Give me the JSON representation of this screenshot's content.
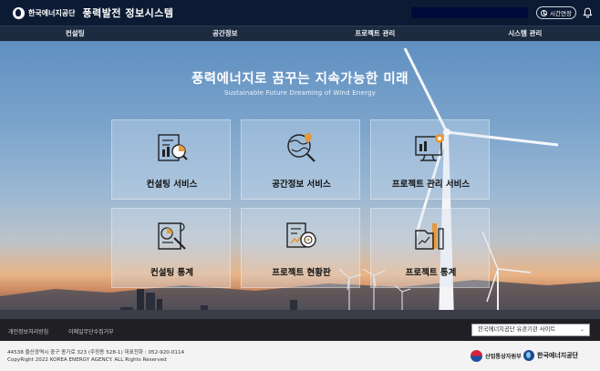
{
  "header": {
    "org_logo_text": "한국에너지공단",
    "system_title": "풍력발전 정보시스템",
    "ext_button_label": "시간연장"
  },
  "nav": {
    "items": [
      {
        "label": "컨설팅"
      },
      {
        "label": "공간정보"
      },
      {
        "label": "프로젝트 관리"
      },
      {
        "label": "시스템 관리"
      }
    ]
  },
  "hero": {
    "title": "풍력에너지로 꿈꾸는 지속가능한 미래",
    "subtitle": "Sustainable Future Dreaming of Wind Energy"
  },
  "services": [
    {
      "label": "컨설팅 서비스",
      "icon": "consulting-service-icon"
    },
    {
      "label": "공간정보 서비스",
      "icon": "spatial-info-icon"
    },
    {
      "label": "프로젝트 관리 서비스",
      "icon": "project-management-icon"
    },
    {
      "label": "컨설팅 통계",
      "icon": "consulting-stats-icon"
    },
    {
      "label": "프로젝트 현황판",
      "icon": "project-dashboard-icon"
    },
    {
      "label": "프로젝트 통계",
      "icon": "project-stats-icon"
    }
  ],
  "footer": {
    "privacy_link": "개인정보처리방침",
    "email_link": "이메일무단수집거부",
    "related_sites_select": "한국에너지공단 유관기관 사이트",
    "address": "44538 울산광역시 중구 종가로 323 (주정동 528-1) 대표전화 : 052-920-0114",
    "copyright": "CopyRight 2022 KOREA ENERGY AGENCY. ALL Rights Reserved",
    "ministry_logo_text": "산업통상자원부",
    "agency_logo_text": "한국에너지공단"
  },
  "colors": {
    "header_bg": "#0c1b33",
    "nav_bg": "#1d2b40",
    "footer_bar_bg": "#1f1f24",
    "footer_bg": "#f3f3f3"
  }
}
